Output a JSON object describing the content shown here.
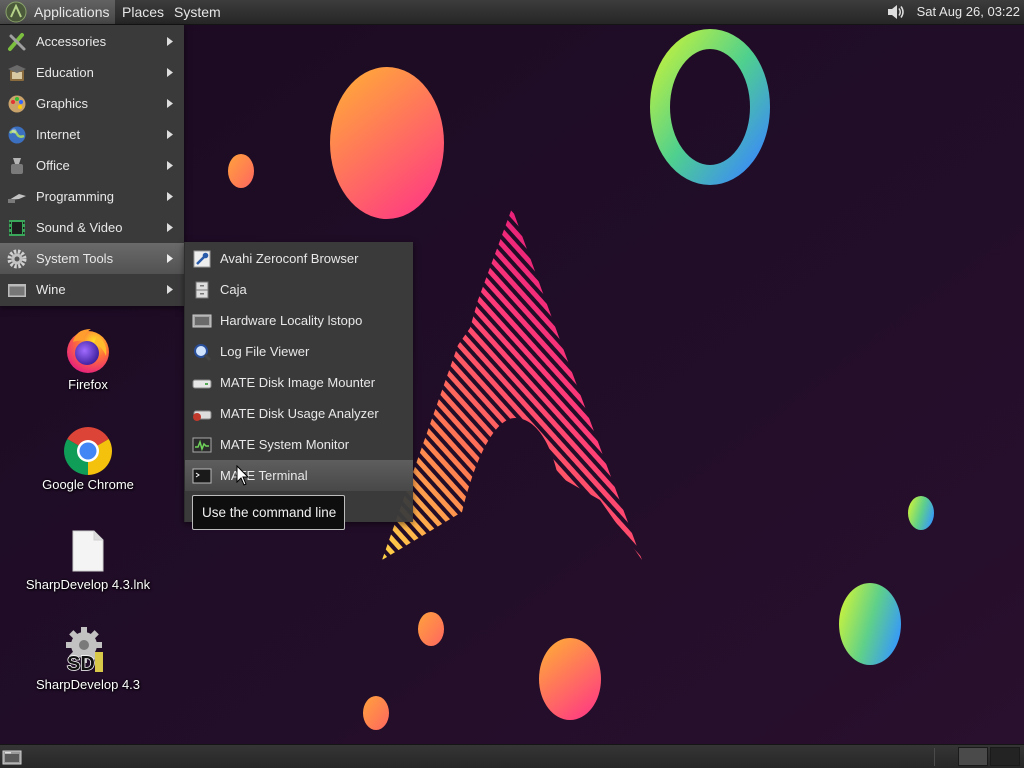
{
  "top_panel": {
    "menus": [
      "Applications",
      "Places",
      "System"
    ],
    "clock": "Sat Aug 26, 03:22",
    "icons": [
      "mate-menu-icon",
      "volume-icon"
    ]
  },
  "app_menu": {
    "items": [
      {
        "label": "Accessories",
        "icon": "accessories-icon",
        "has_submenu": true
      },
      {
        "label": "Education",
        "icon": "education-icon",
        "has_submenu": true
      },
      {
        "label": "Graphics",
        "icon": "graphics-icon",
        "has_submenu": true
      },
      {
        "label": "Internet",
        "icon": "internet-globe-icon",
        "has_submenu": true
      },
      {
        "label": "Office",
        "icon": "office-icon",
        "has_submenu": true
      },
      {
        "label": "Programming",
        "icon": "programming-icon",
        "has_submenu": true
      },
      {
        "label": "Sound & Video",
        "icon": "sound-video-icon",
        "has_submenu": true
      },
      {
        "label": "System Tools",
        "icon": "system-tools-gear-icon",
        "has_submenu": true,
        "selected": true
      },
      {
        "label": "Wine",
        "icon": "wine-icon",
        "has_submenu": true
      }
    ]
  },
  "system_tools_submenu": {
    "items": [
      {
        "label": "Avahi Zeroconf Browser",
        "icon": "avahi-browser-icon"
      },
      {
        "label": "Caja",
        "icon": "file-cabinet-icon"
      },
      {
        "label": "Hardware Locality lstopo",
        "icon": "hardware-icon"
      },
      {
        "label": "Log File Viewer",
        "icon": "magnifier-icon"
      },
      {
        "label": "MATE Disk Image Mounter",
        "icon": "disk-image-icon"
      },
      {
        "label": "MATE Disk Usage Analyzer",
        "icon": "disk-usage-icon"
      },
      {
        "label": "MATE System Monitor",
        "icon": "system-monitor-icon"
      },
      {
        "label": "MATE Terminal",
        "icon": "terminal-icon",
        "hovered": true
      }
    ]
  },
  "tooltip": {
    "text": "Use the command line"
  },
  "desktop_icons": [
    {
      "label": "Firefox",
      "icon": "firefox-icon"
    },
    {
      "label": "Google Chrome",
      "icon": "chrome-icon"
    },
    {
      "label": "SharpDevelop 4.3.lnk",
      "icon": "file-icon"
    },
    {
      "label": "SharpDevelop 4.3",
      "icon": "sharpdevelop-icon",
      "logo_text": "SD"
    }
  ],
  "colors": {
    "desktop_background": "#1f0d24",
    "menu_background": "#3c3c3c",
    "menu_highlight": "#5e5e5e",
    "panel_background": "#2b2b2b",
    "menu_text": "#e8e8e8"
  }
}
